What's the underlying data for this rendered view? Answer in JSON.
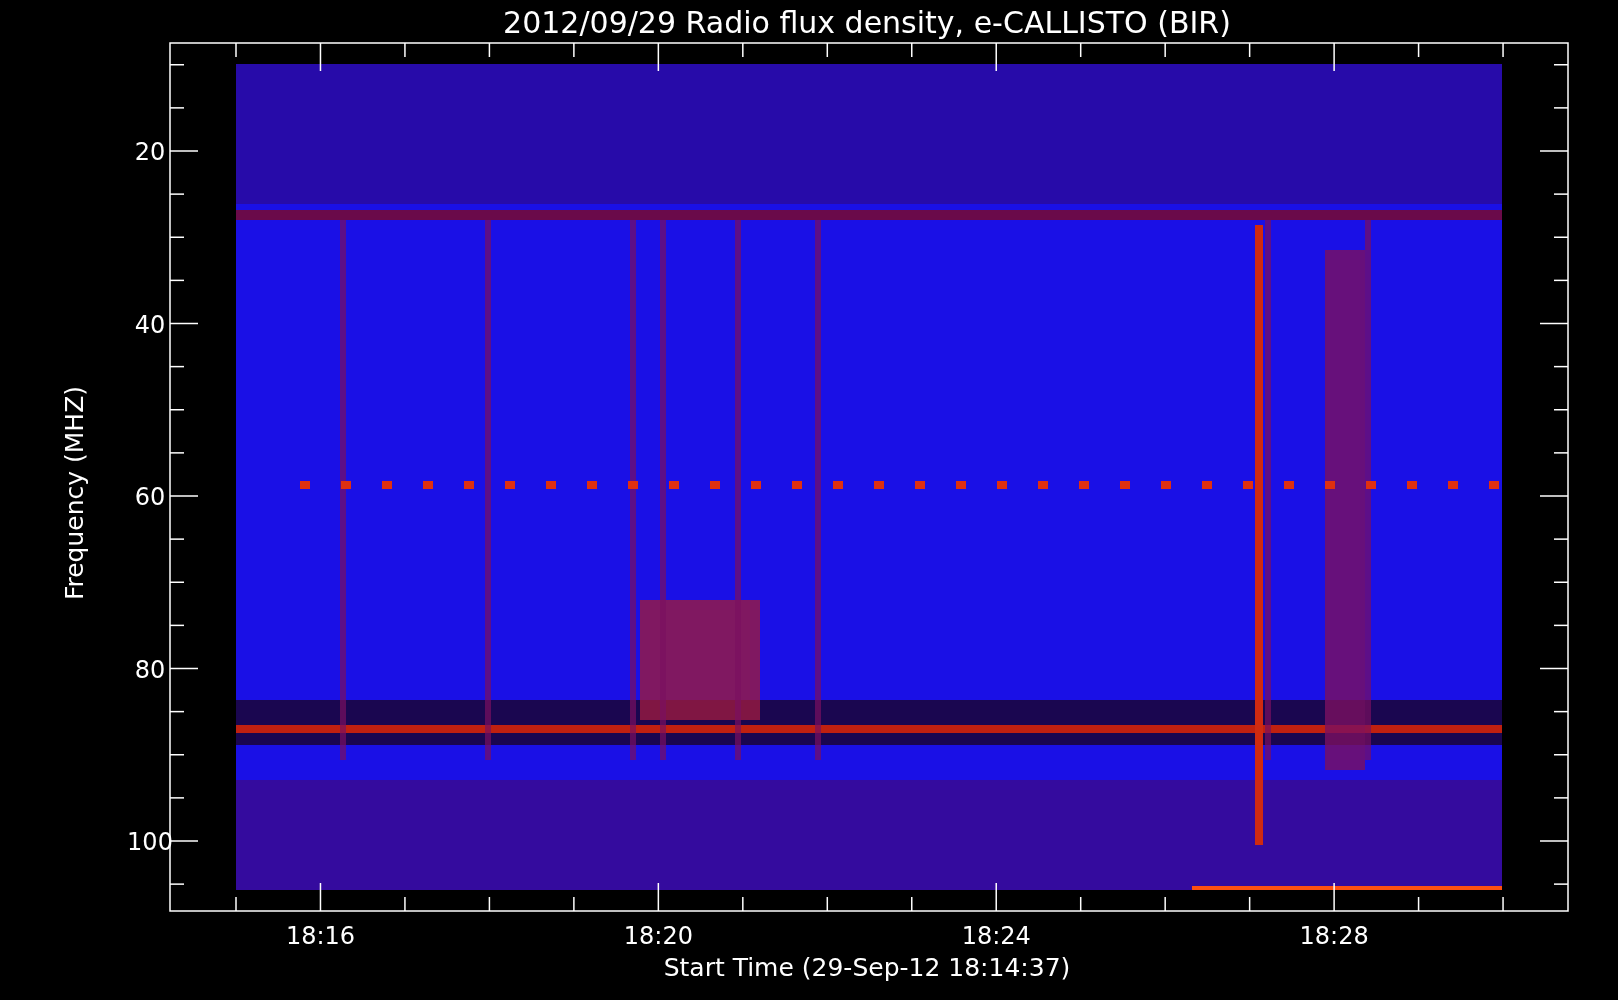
{
  "title": "2012/09/29  Radio flux density, e-CALLISTO (BIR)",
  "ylabel": "Frequency (MHZ)",
  "xlabel": "Start Time (29-Sep-12 18:14:37)",
  "yticks": [
    "20",
    "40",
    "60",
    "80",
    "100"
  ],
  "xticks": [
    "18:16",
    "18:20",
    "18:24",
    "18:28"
  ],
  "spectrogram": {
    "kind": "picture"
  }
}
